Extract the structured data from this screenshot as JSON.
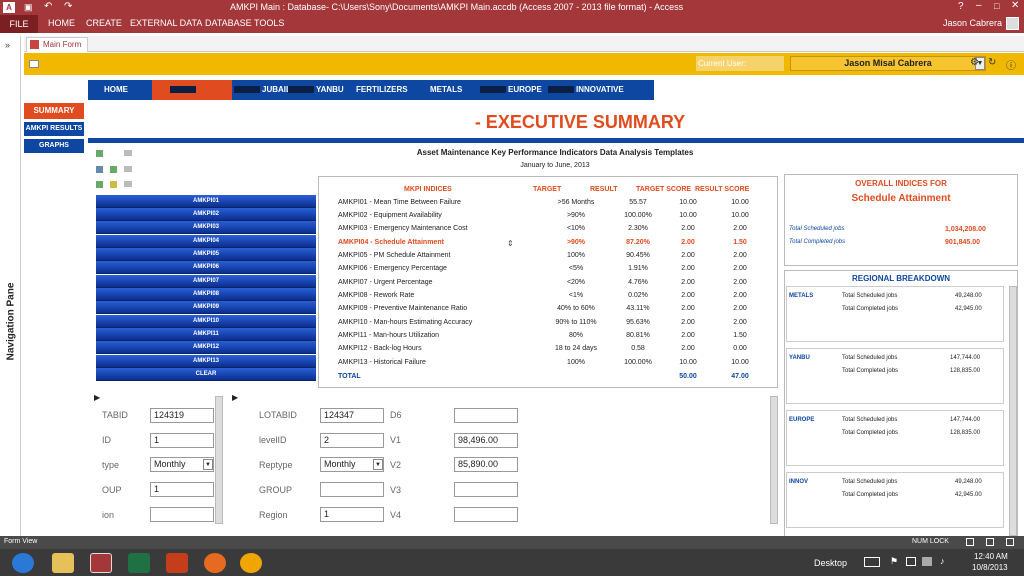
{
  "window": {
    "title": "AMKPI Main : Database- C:\\Users\\Sony\\Documents\\AMKPI Main.accdb (Access 2007 - 2013 file format) - Access",
    "user": "Jason Cabrera"
  },
  "ribbon": {
    "tabs": [
      "FILE",
      "HOME",
      "CREATE",
      "EXTERNAL DATA",
      "DATABASE TOOLS"
    ]
  },
  "navpane": {
    "label": "Navigation Pane"
  },
  "form_tab": {
    "label": "Main Form"
  },
  "userbar": {
    "current_label": "Current User:",
    "current_value": "Jason Misal Cabrera"
  },
  "sidemenu": {
    "items": [
      "SUMMARY",
      "AMKPI RESULTS",
      "GRAPHS"
    ]
  },
  "navbar": {
    "items": [
      "HOME",
      "JUBAIL",
      "YANBU",
      "FERTILIZERS",
      "METALS",
      "EUROPE",
      "INNOVATIVE"
    ]
  },
  "main": {
    "headline": "- EXECUTIVE SUMMARY",
    "subtitle": "Asset Maintenance Key Performance Indicators  Data Analysis Templates",
    "date_range": "January to June, 2013"
  },
  "kpi_buttons": [
    "AMKPI01",
    "AMKPI02",
    "AMKPI03",
    "AMKPI04",
    "AMKPI05",
    "AMKPI06",
    "AMKPI07",
    "AMKPI08",
    "AMKPI09",
    "AMKPI10",
    "AMKPI11",
    "AMKPI12",
    "AMKPI13",
    "CLEAR"
  ],
  "kpi_table": {
    "headers": [
      "MKPI INDICES",
      "TARGET",
      "RESULT",
      "TARGET SCORE",
      "RESULT SCORE"
    ],
    "rows": [
      [
        "AMKPI01 - Mean Time Between Failure",
        ">56 Months",
        "55.57",
        "10.00",
        "10.00"
      ],
      [
        "AMKPI02 - Equipment Availability",
        ">90%",
        "100.00%",
        "10.00",
        "10.00"
      ],
      [
        "AMKPI03 - Emergency Maintenance Cost",
        "<10%",
        "2.30%",
        "2.00",
        "2.00"
      ],
      [
        "AMKPI04 - Schedule Attainment",
        ">90%",
        "87.20%",
        "2.00",
        "1.50"
      ],
      [
        "AMKPI05 - PM Schedule Attainment",
        "100%",
        "90.45%",
        "2.00",
        "2.00"
      ],
      [
        "AMKPI06 - Emergency Percentage",
        "<5%",
        "1.91%",
        "2.00",
        "2.00"
      ],
      [
        "AMKPI07 - Urgent Percentage",
        "<20%",
        "4.76%",
        "2.00",
        "2.00"
      ],
      [
        "AMKPI08 - Rework Rate",
        "<1%",
        "0.02%",
        "2.00",
        "2.00"
      ],
      [
        "AMKPI09 - Preventive Maintenance Ratio",
        "40% to 60%",
        "43.11%",
        "2.00",
        "2.00"
      ],
      [
        "AMKPI10 - Man-hours Estimating Accuracy",
        "90% to 110%",
        "95.63%",
        "2.00",
        "2.00"
      ],
      [
        "AMKPI11 - Man-hours Utilization",
        "80%",
        "80.81%",
        "2.00",
        "1.50"
      ],
      [
        "AMKPI12 - Back-log Hours",
        "18 to 24 days",
        "0.58",
        "2.00",
        "0.00"
      ],
      [
        "AMKPI13 - Historical Failure",
        "100%",
        "100.00%",
        "10.00",
        "10.00"
      ]
    ],
    "total": {
      "label": "TOTAL",
      "target_score": "50.00",
      "result_score": "47.00"
    }
  },
  "overall": {
    "title1": "OVERALL INDICES FOR",
    "title2": "Schedule Attainment",
    "rows": [
      {
        "label": "Total Scheduled jobs",
        "value": "1,034,208.00"
      },
      {
        "label": "Total Completed jobs",
        "value": "901,845.00"
      }
    ]
  },
  "regional": {
    "title": "REGIONAL BREAKDOWN",
    "blocks": [
      {
        "region": "METALS",
        "scheduled": "49,248.00",
        "completed": "42,945.00"
      },
      {
        "region": "YANBU",
        "scheduled": "147,744.00",
        "completed": "128,835.00"
      },
      {
        "region": "EUROPE",
        "scheduled": "147,744.00",
        "completed": "128,835.00"
      },
      {
        "region": "INNOV",
        "scheduled": "49,248.00",
        "completed": "42,945.00"
      }
    ],
    "row_labels": {
      "scheduled": "Total Scheduled jobs",
      "completed": "Total Completed jobs"
    }
  },
  "subform_left": {
    "labels": [
      "TABID",
      "ID",
      "type",
      "OUP",
      "ion"
    ],
    "values": [
      "124319",
      "1",
      "Monthly",
      "1",
      ""
    ]
  },
  "subform_right": {
    "labels": [
      "LOTABID",
      "levelID",
      "Reptype",
      "GROUP",
      "Region"
    ],
    "values": [
      "124347",
      "2",
      "Monthly",
      "",
      "1"
    ],
    "labels2": [
      "D6",
      "V1",
      "V2",
      "V3",
      "V4"
    ],
    "values2": [
      "",
      "98,496.00",
      "85,890.00",
      "",
      ""
    ]
  },
  "statusbar": {
    "left": "Form View",
    "right": "NUM LOCK"
  },
  "taskbar": {
    "desktop": "Desktop",
    "time": "12:40 AM",
    "date": "10/8/2013"
  }
}
